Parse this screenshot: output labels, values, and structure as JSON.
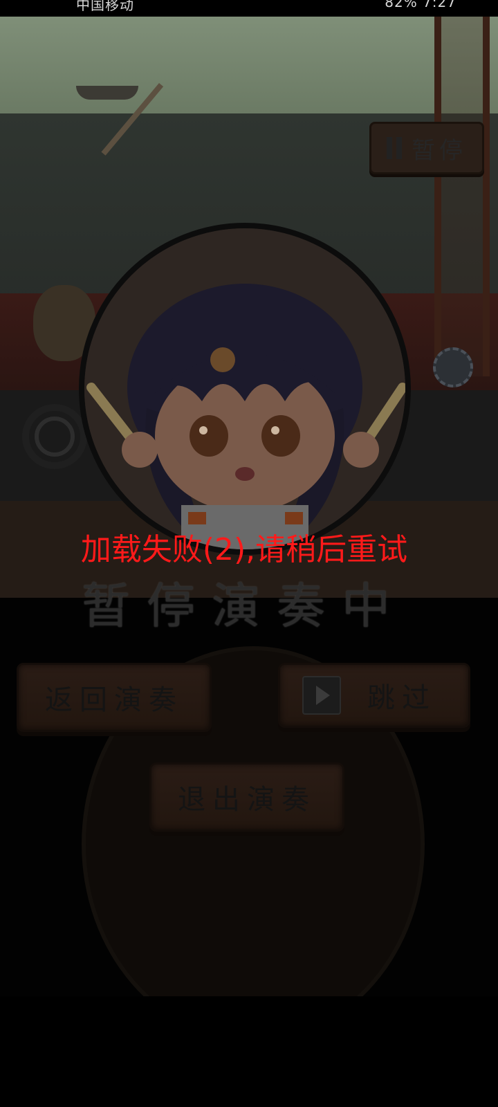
{
  "status_bar": {
    "carrier": "中国移动",
    "battery": "82%",
    "time": "7:27"
  },
  "pause_button": {
    "label": "暂停"
  },
  "error_message": "加载失败(2),请稍后重试",
  "paused_title": "暂停演奏中",
  "buttons": {
    "resume": "返回演奏",
    "skip": "跳过",
    "exit": "退出演奏"
  },
  "colors": {
    "error_red": "#ff1a1a",
    "overlay": "#000000"
  },
  "icons": {
    "pause": "pause-icon",
    "skip": "video-skip-icon"
  }
}
